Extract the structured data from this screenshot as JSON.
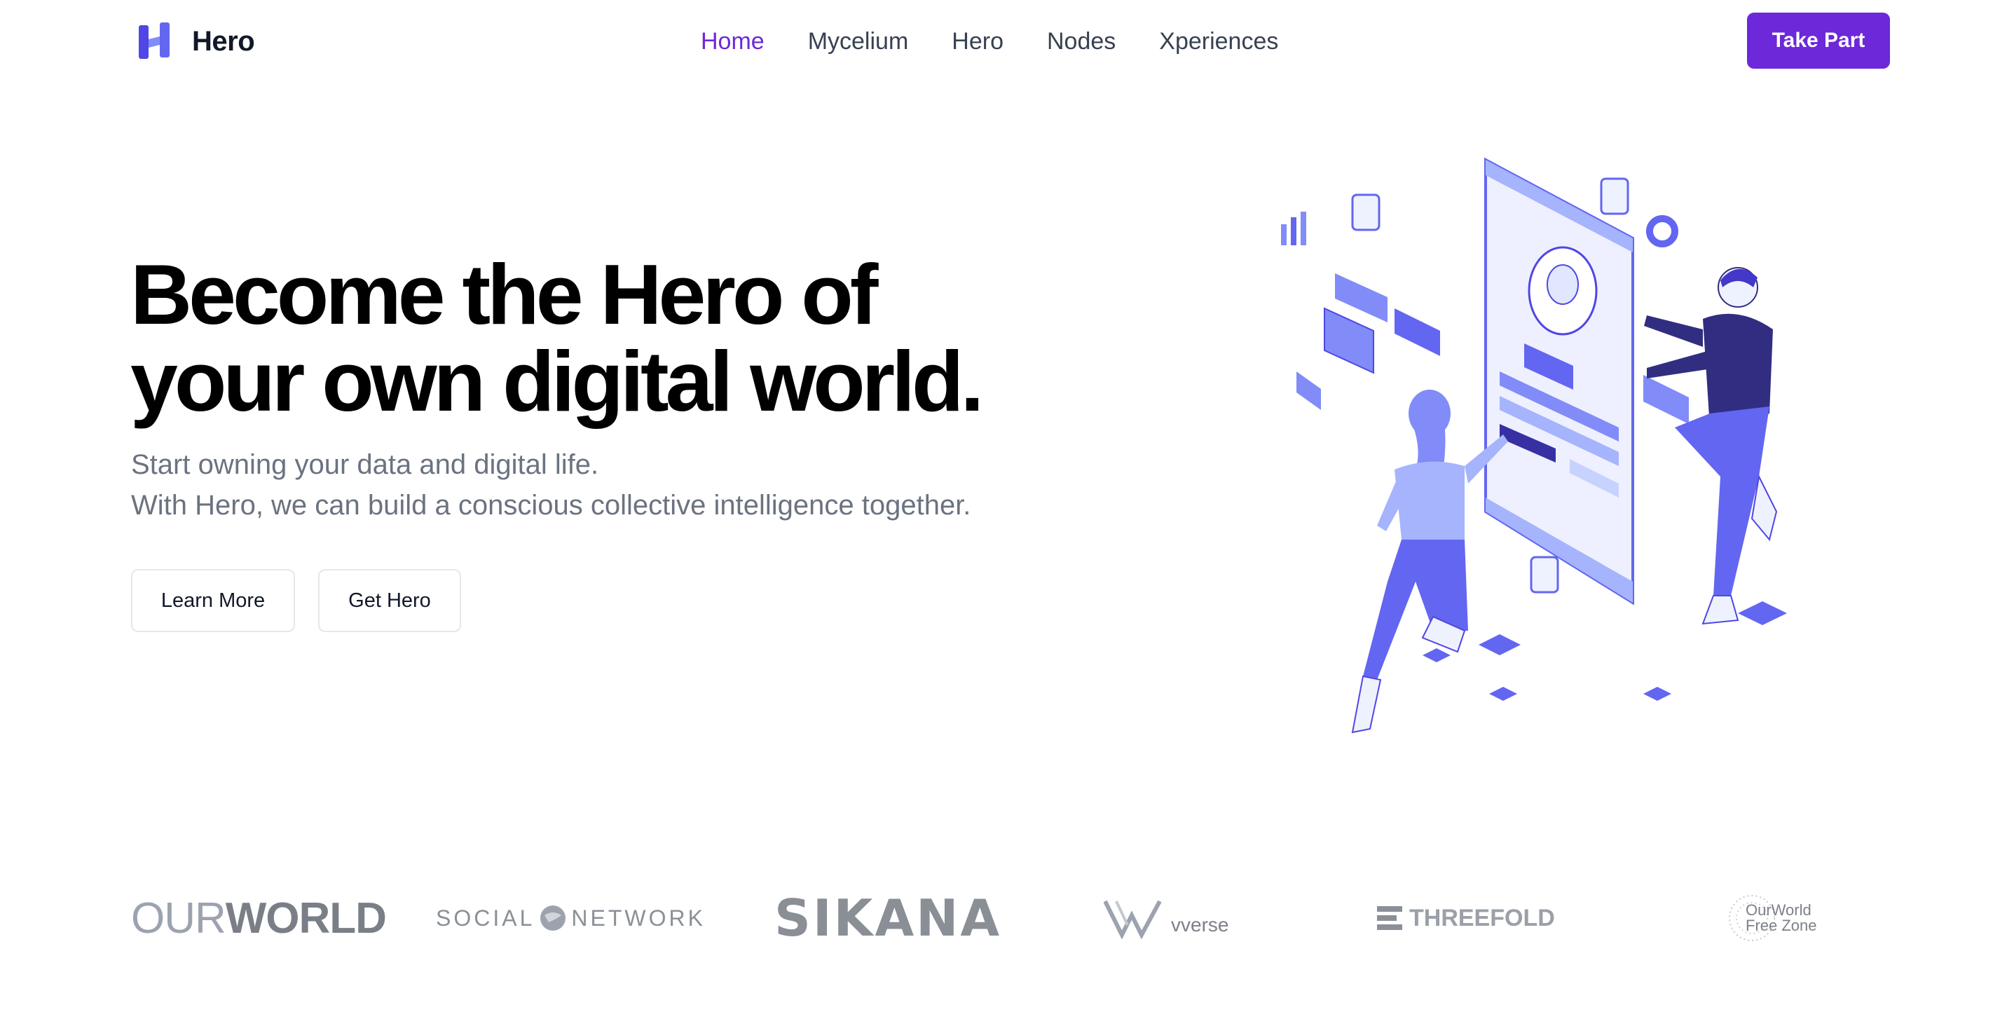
{
  "brand": {
    "name": "Hero",
    "accent": "#6d28d9",
    "logo_icon": "h-letter-logo-icon"
  },
  "nav": {
    "items": [
      {
        "label": "Home",
        "active": true
      },
      {
        "label": "Mycelium"
      },
      {
        "label": "Hero"
      },
      {
        "label": "Nodes"
      },
      {
        "label": "Xperiences"
      }
    ],
    "cta_label": "Take Part"
  },
  "hero": {
    "title_line1": "Become the Hero of",
    "title_line2": "your own digital world.",
    "subtitle_line1": "Start owning your data and digital life.",
    "subtitle_line2": "With Hero, we can build a conscious collective intelligence together.",
    "learn_more_label": "Learn More",
    "get_hero_label": "Get Hero",
    "illustration": "people-interacting-with-phone-profile-illustration",
    "illustration_color": "#6366f1"
  },
  "partners": {
    "ourworld": {
      "light": "OUR",
      "bold": "WORLD"
    },
    "social_network": {
      "left": "SOCIAL",
      "right": "NETWORK"
    },
    "sikana": "SIKANA",
    "vverse": "vverse",
    "threefold": "THREEFOLD",
    "freezone": {
      "line1": "OurWorld",
      "line2": "Free Zone"
    }
  }
}
